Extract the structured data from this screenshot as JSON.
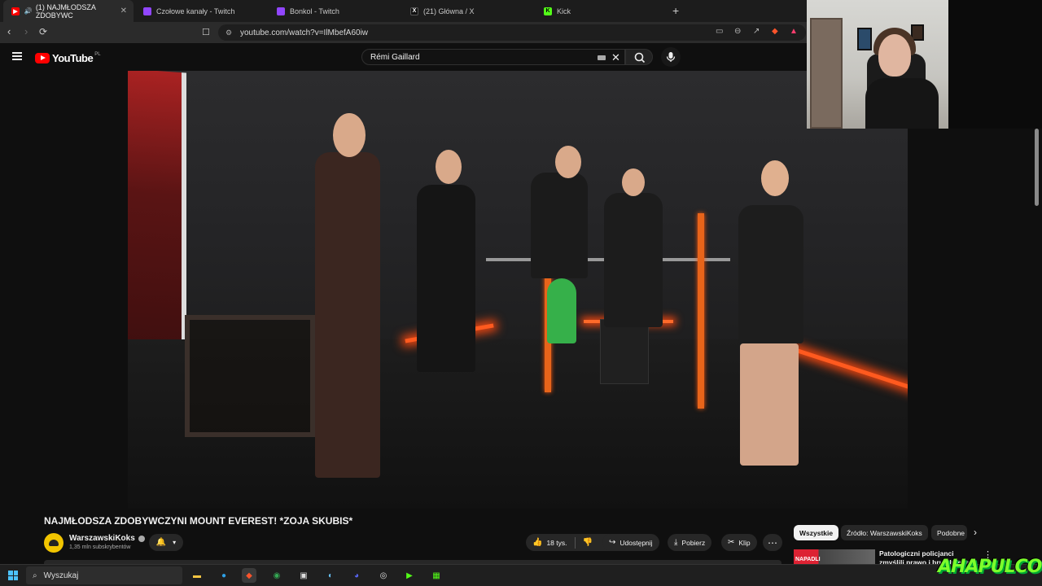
{
  "browser": {
    "tabs": [
      {
        "label": "(1) NAJMŁODSZA ZDOBYWC",
        "favicon_color": "#ff0000",
        "active": true
      },
      {
        "label": "Czołowe kanały - Twitch",
        "favicon_color": "#9146ff",
        "active": false
      },
      {
        "label": "Bonkol - Twitch",
        "favicon_color": "#9146ff",
        "active": false
      },
      {
        "label": "(21) Główna / X",
        "favicon_color": "#111111",
        "active": false
      },
      {
        "label": "Kick",
        "favicon_color": "#53fc18",
        "active": false
      }
    ],
    "new_tab": "+",
    "url": "youtube.com/watch?v=IlMbefA60iw"
  },
  "youtube": {
    "logo_text": "YouTube",
    "country_code": "PL",
    "search_value": "Rémi Gaillard"
  },
  "video": {
    "title": "NAJMŁODSZA ZDOBYWCZYNI MOUNT EVEREST! *ZOJA SKUBIS*",
    "channel_name": "WarszawskiKoks",
    "subscribers": "1,35 mln subskrybentów",
    "likes": "18 tys.",
    "share_label": "Udostępnij",
    "download_label": "Pobierz",
    "clip_label": "Klip"
  },
  "sidebar": {
    "chips": [
      {
        "label": "Wszystkie",
        "selected": true
      },
      {
        "label": "Źródło: WarszawskiKoks",
        "selected": false
      },
      {
        "label": "Podobne",
        "selected": false
      }
    ],
    "recommended_title": "Patologiczni policjanci zmyślili prawo i brutalnie je na mnie",
    "recommended_thumb_text": "NAPADLI"
  },
  "overlay": {
    "logo_text": "AHAPULCO"
  },
  "taskbar": {
    "search_placeholder": "Wyszukaj"
  },
  "colors": {
    "youtube_red": "#ff0000",
    "kick_green": "#53fc18",
    "twitch_purple": "#9146ff",
    "windows_blue": "#4cc2ff"
  }
}
